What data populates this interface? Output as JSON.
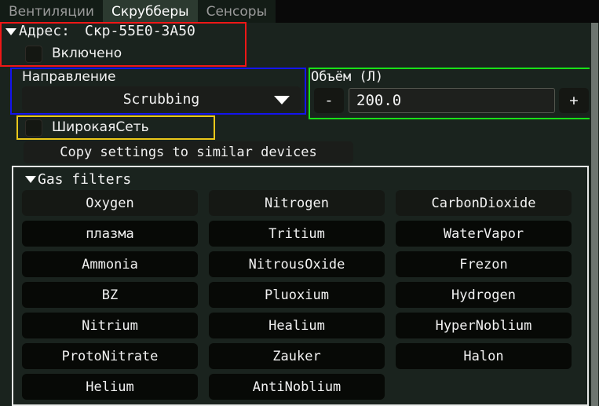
{
  "tabs": [
    {
      "label": "Вентиляции",
      "active": false
    },
    {
      "label": "Скрубберы",
      "active": true
    },
    {
      "label": "Сенсоры",
      "active": false
    }
  ],
  "address_section": {
    "label": "Адрес:",
    "value": "Скр-55E0-3A50",
    "enabled_label": "Включено",
    "enabled_checked": false,
    "frame_color": "#ef1717"
  },
  "direction_section": {
    "label": "Направление",
    "selected": "Scrubbing",
    "frame_color": "#1414ee"
  },
  "volume_section": {
    "label": "Объём (Л)",
    "decrement_label": "-",
    "increment_label": "+",
    "value": "200.0",
    "frame_color": "#18e018"
  },
  "wide_net": {
    "label": "ШирокаяСеть",
    "checked": false,
    "frame_color": "#eac81a"
  },
  "copy_settings": {
    "label": "Copy settings to similar devices"
  },
  "gas_filters": {
    "title": "Gas filters",
    "frame_color": "#e8eae8",
    "items": [
      "Oxygen",
      "Nitrogen",
      "CarbonDioxide",
      "плазма",
      "Tritium",
      "WaterVapor",
      "Ammonia",
      "NitrousOxide",
      "Frezon",
      "BZ",
      "Pluoxium",
      "Hydrogen",
      "Nitrium",
      "Healium",
      "HyperNoblium",
      "ProtoNitrate",
      "Zauker",
      "Halon",
      "Helium",
      "AntiNoblium"
    ]
  },
  "theme": {
    "background": "#1a231e",
    "tabbar_background": "#090909",
    "active_tab_background": "#2c3a30",
    "text": "#f2f2f2",
    "muted_text": "#9a9a9a"
  }
}
